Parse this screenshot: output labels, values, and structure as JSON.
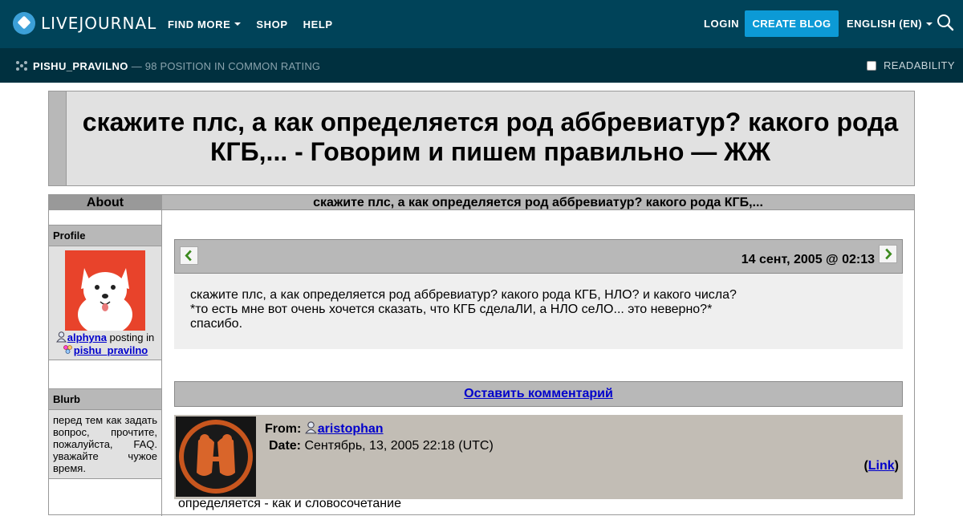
{
  "topnav": {
    "logo_text": "LIVEJOURNAL",
    "items": [
      "FIND MORE",
      "SHOP",
      "HELP"
    ],
    "login": "LOGIN",
    "create_blog": "CREATE BLOG",
    "language": "ENGLISH (EN)"
  },
  "subbar": {
    "community": "PISHU_PRAVILNO",
    "rating": "— 98 POSITION IN COMMON RATING",
    "readability": "READABILITY"
  },
  "page_title": "скажите плс, а как определяется род аббревиатур? какого рода КГБ,... - Говорим и пишем правильно — ЖЖ",
  "sidebar": {
    "about": "About",
    "profile_label": "Profile",
    "poster": "alphyna",
    "posting_in": "posting in",
    "community": "pishu_pravilno",
    "blurb_label": "Blurb",
    "blurb_text": "перед тем как задать вопрос, прочтите, пожалуйста, FAQ. уважайте чужое время."
  },
  "entry": {
    "header": "скажите плс, а как определяется род аббревиатур? какого рода КГБ,...",
    "date": "14 сент, 2005 @ 02:13",
    "lines": [
      "скажите плс, а как определяется род аббревиатур? какого рода КГБ, НЛО? и какого числа?",
      "*то есть мне вот очень хочется сказать, что КГБ сделаЛИ, а НЛО сеЛО... это неверно?*",
      "спасибо."
    ],
    "leave_comment": "Оставить комментарий"
  },
  "comment": {
    "from_label": "From:",
    "author": "aristophan",
    "date_label": "Date:",
    "date": "Сентябрь, 13, 2005 22:18 (UTC)",
    "link_label": "Link",
    "text": "определяется - как и словосочетание"
  },
  "colors": {
    "topbar": "#004359",
    "subbar": "#00303f",
    "accent": "#0c9ad6",
    "link": "#0000cc"
  },
  "icons": {
    "search": "search-icon",
    "community": "community-icon",
    "prev": "arrow-left-icon",
    "next": "arrow-right-icon",
    "user": "user-icon"
  }
}
